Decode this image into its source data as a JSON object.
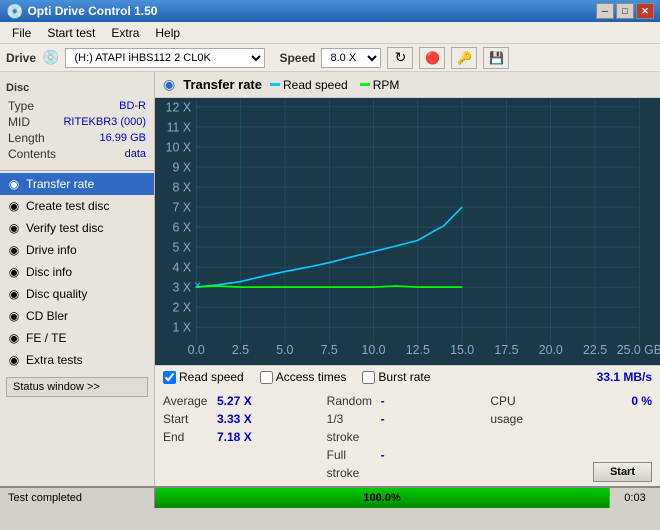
{
  "titleBar": {
    "title": "Opti Drive Control 1.50",
    "minimizeBtn": "─",
    "maximizeBtn": "□",
    "closeBtn": "✕"
  },
  "menuBar": {
    "items": [
      "File",
      "Start test",
      "Extra",
      "Help"
    ]
  },
  "driveBar": {
    "driveLabel": "Drive",
    "driveValue": "(H:)  ATAPI iHBS112  2 CL0K",
    "speedLabel": "Speed",
    "speedValue": "8.0 X",
    "refreshIcon": "↻",
    "icon2": "🔴",
    "icon3": "🔑",
    "saveIcon": "💾"
  },
  "disc": {
    "sectionLabel": "Disc",
    "rows": [
      {
        "label": "Type",
        "value": "BD-R"
      },
      {
        "label": "MID",
        "value": "RITEKBR3 (000)"
      },
      {
        "label": "Length",
        "value": "16.99 GB"
      },
      {
        "label": "Contents",
        "value": "data"
      }
    ]
  },
  "sidebar": {
    "items": [
      {
        "label": "Transfer rate",
        "icon": "◉",
        "active": true
      },
      {
        "label": "Create test disc",
        "icon": "◉",
        "active": false
      },
      {
        "label": "Verify test disc",
        "icon": "◉",
        "active": false
      },
      {
        "label": "Drive info",
        "icon": "◉",
        "active": false
      },
      {
        "label": "Disc info",
        "icon": "◉",
        "active": false
      },
      {
        "label": "Disc quality",
        "icon": "◉",
        "active": false
      },
      {
        "label": "CD Bler",
        "icon": "◉",
        "active": false
      },
      {
        "label": "FE / TE",
        "icon": "◉",
        "active": false
      },
      {
        "label": "Extra tests",
        "icon": "◉",
        "active": false
      }
    ],
    "statusBtn": "Status window >>"
  },
  "graph": {
    "title": "Transfer rate",
    "icon": "◉",
    "legend": [
      {
        "label": "Read speed",
        "color": "#00ccff"
      },
      {
        "label": "RPM",
        "color": "#00ff00"
      }
    ],
    "yAxis": [
      "12 X",
      "11 X",
      "10 X",
      "9 X",
      "8 X",
      "7 X",
      "6 X",
      "5 X",
      "4 X",
      "3 X",
      "2 X",
      "1 X"
    ],
    "xAxis": [
      "0.0",
      "2.5",
      "5.0",
      "7.5",
      "10.0",
      "12.5",
      "15.0",
      "17.5",
      "20.0",
      "22.5",
      "25.0 GB"
    ]
  },
  "checkboxRow": {
    "readSpeed": {
      "label": "Read speed",
      "checked": true
    },
    "accessTimes": {
      "label": "Access times",
      "checked": false
    },
    "burstRate": {
      "label": "Burst rate",
      "checked": false
    },
    "burstValue": "33.1 MB/s"
  },
  "stats": {
    "average": {
      "label": "Average",
      "value": "5.27 X"
    },
    "start": {
      "label": "Start",
      "value": "3.33 X"
    },
    "end": {
      "label": "End",
      "value": "7.18 X"
    },
    "random": {
      "label": "Random",
      "value": "-"
    },
    "oneThird": {
      "label": "1/3 stroke",
      "value": "-"
    },
    "fullStroke": {
      "label": "Full stroke",
      "value": "-"
    },
    "cpuUsage": {
      "label": "CPU usage",
      "value": "0 %"
    },
    "startBtn": "Start"
  },
  "statusBar": {
    "text": "Test completed",
    "progress": "100.0%",
    "progressWidth": 100,
    "time": "0:03"
  }
}
